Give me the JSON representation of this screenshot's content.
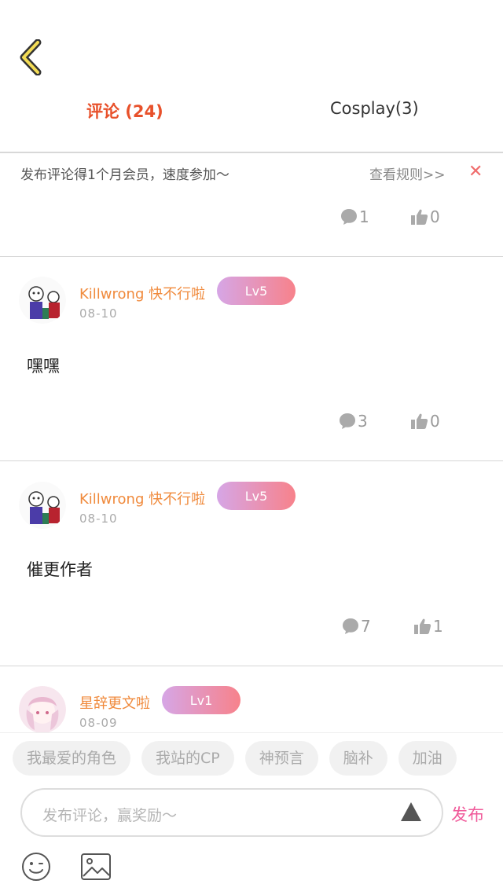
{
  "header": {
    "tabs": [
      {
        "label": "评论 (24)"
      },
      {
        "label": "Cosplay(3)"
      }
    ]
  },
  "notice": {
    "text": "发布评论得1个月会员，速度参加～",
    "rules_link": "查看规则>>",
    "close_symbol": "✕"
  },
  "top_stats": {
    "comments": "1",
    "likes": "0"
  },
  "comments": [
    {
      "username": "Killwrong 快不行啦",
      "level": "Lv5",
      "date": "08-10",
      "text": "嘿嘿",
      "comment_count": "3",
      "like_count": "0"
    },
    {
      "username": "Killwrong 快不行啦",
      "level": "Lv5",
      "date": "08-10",
      "text": "催更作者",
      "comment_count": "7",
      "like_count": "1"
    },
    {
      "username": "星辞更文啦",
      "level": "Lv1",
      "date": "08-09"
    }
  ],
  "quick_tags": [
    "我最爱的角色",
    "我站的CP",
    "神预言",
    "脑补",
    "加油"
  ],
  "composer": {
    "placeholder": "发布评论，赢奖励～",
    "publish_label": "发布"
  },
  "colors": {
    "accent": "#e8512b",
    "username": "#f08a3c",
    "publish": "#f05a9a",
    "close": "#f06c6c"
  },
  "icons": [
    "back-chevron-icon",
    "comment-bubble-icon",
    "thumbs-up-icon",
    "emoji-icon",
    "image-icon",
    "triangle-send-icon"
  ]
}
